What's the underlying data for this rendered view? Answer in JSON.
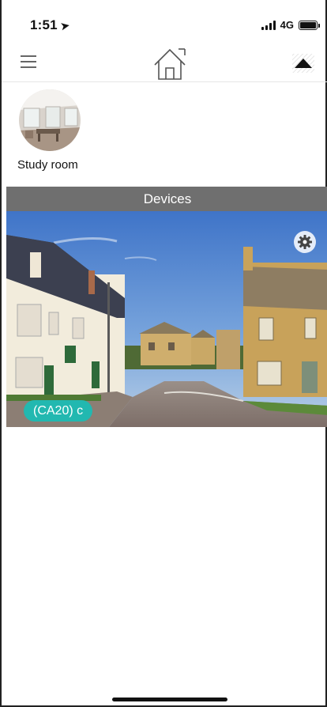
{
  "status_bar": {
    "time": "1:51",
    "network": "4G"
  },
  "nav": {
    "menu_icon": "menu-icon",
    "home_icon": "home-icon",
    "collapse_icon": "triangle-up-icon"
  },
  "rooms": [
    {
      "label": "Study room"
    }
  ],
  "devices_section": {
    "title": "Devices"
  },
  "devices": [
    {
      "label": "(CA20) c",
      "settings_icon": "gear-icon"
    }
  ],
  "colors": {
    "section_header_bg": "#6f6f6f",
    "badge_bg": "#22b8b0"
  }
}
